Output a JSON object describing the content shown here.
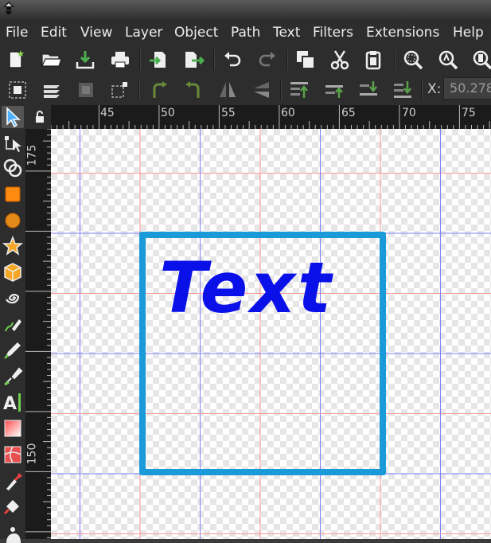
{
  "menu": [
    "File",
    "Edit",
    "View",
    "Layer",
    "Object",
    "Path",
    "Text",
    "Filters",
    "Extensions",
    "Help"
  ],
  "controls": {
    "x_label": "X:",
    "x_value": "50.278"
  },
  "ruler": {
    "horizontal_labels": [
      "45",
      "50",
      "55",
      "60",
      "65",
      "70",
      "75"
    ],
    "vertical_labels": [
      "175",
      "150"
    ]
  },
  "canvas": {
    "text": "Text"
  },
  "colors": {
    "frame_stroke": "#1a9ad9",
    "text_fill": "#0a10e8",
    "grid_major": "#8080ff",
    "grid_minor": "#ff9a9a"
  },
  "icons": {
    "command_bar": [
      "new-document-icon",
      "open-icon",
      "save-icon",
      "print-icon",
      "import-icon",
      "export-icon",
      "undo-icon",
      "redo-icon",
      "duplicate-icon",
      "cut-icon",
      "paste-icon",
      "zoom-selection-icon",
      "zoom-drawing-icon",
      "zoom-page-icon"
    ],
    "control_bar": [
      "select-all-icon",
      "select-all-layers-icon",
      "deselect-icon",
      "select-same-icon",
      "rotate-ccw-icon",
      "rotate-cw-icon",
      "flip-horizontal-icon",
      "flip-vertical-icon",
      "raise-to-top-icon",
      "raise-icon",
      "lower-icon",
      "lower-to-bottom-icon"
    ],
    "toolbox": [
      "selector-tool-icon",
      "node-tool-icon",
      "tweak-tool-icon",
      "rectangle-tool-icon",
      "ellipse-tool-icon",
      "star-tool-icon",
      "box3d-tool-icon",
      "spiral-tool-icon",
      "pencil-tool-icon",
      "pen-tool-icon",
      "calligraphy-tool-icon",
      "text-tool-icon",
      "gradient-tool-icon",
      "mesh-tool-icon",
      "dropper-tool-icon",
      "paint-bucket-tool-icon",
      "spray-tool-icon"
    ]
  }
}
